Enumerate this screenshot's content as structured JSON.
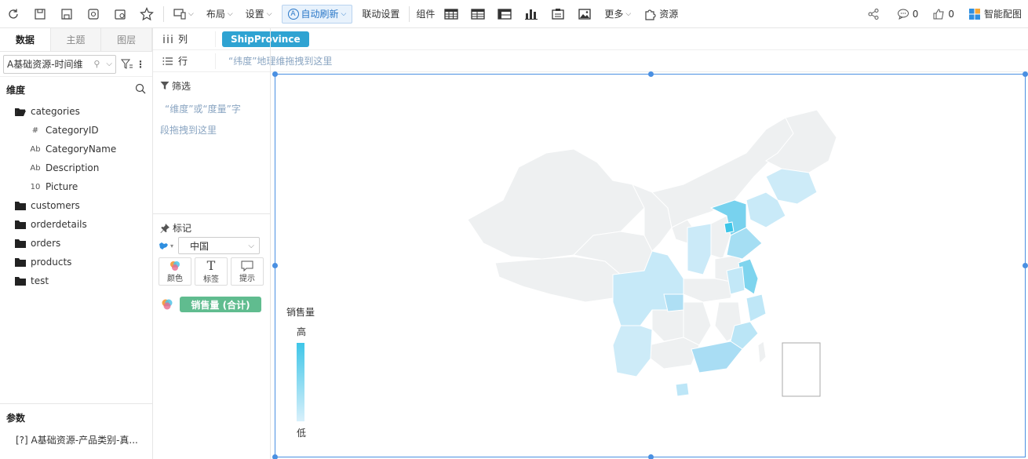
{
  "toolbar": {
    "layout_label": "布局",
    "settings_label": "设置",
    "auto_refresh_label": "自动刷新",
    "linkage_label": "联动设置",
    "component_label": "组件",
    "more_label": "更多",
    "resource_label": "资源",
    "comments_count": "0",
    "likes_count": "0",
    "smart_color_label": "智能配图"
  },
  "left_panel": {
    "tabs": [
      "数据",
      "主题",
      "图层"
    ],
    "datasource": "A基础资源-时间维",
    "dimension_title": "维度",
    "tree": [
      {
        "label": "categories",
        "level": 0,
        "icon": "folder-open-icon"
      },
      {
        "label": "CategoryID",
        "level": 1,
        "icon": "#"
      },
      {
        "label": "CategoryName",
        "level": 1,
        "icon": "Ab"
      },
      {
        "label": "Description",
        "level": 1,
        "icon": "Ab"
      },
      {
        "label": "Picture",
        "level": 1,
        "icon": "10"
      },
      {
        "label": "customers",
        "level": 0,
        "icon": "folder-icon"
      },
      {
        "label": "orderdetails",
        "level": 0,
        "icon": "folder-icon"
      },
      {
        "label": "orders",
        "level": 0,
        "icon": "folder-icon"
      },
      {
        "label": "products",
        "level": 0,
        "icon": "folder-icon"
      },
      {
        "label": "test",
        "level": 0,
        "icon": "folder-icon"
      }
    ],
    "params_title": "参数",
    "param_item": "[?] A基础资源-产品类别-真..."
  },
  "shelves": {
    "columns_label": "列",
    "column_pill": "ShipProvince",
    "rows_label": "行",
    "rows_hint": "“纬度”地理维拖拽到这里"
  },
  "mid_panel": {
    "filter_title": "筛选",
    "filter_hint_line1": "“维度”或“度量”字",
    "filter_hint_line2": "段拖拽到这里",
    "mark_title": "标记",
    "map_select": "中国",
    "mark_buttons": [
      "颜色",
      "标签",
      "提示"
    ],
    "measure_pill": "销售量 (合计)"
  },
  "chart": {
    "legend_title": "销售量",
    "legend_high": "高",
    "legend_low": "低",
    "colors": {
      "high": "#3fc6e8",
      "low": "#d8f0fb",
      "base": "#eef0f1"
    }
  }
}
